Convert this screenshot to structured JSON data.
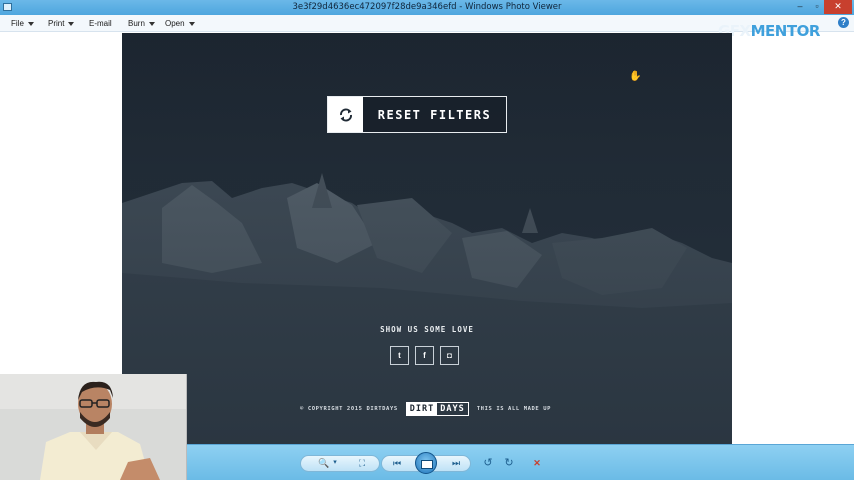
{
  "window": {
    "title": "3e3f29d4636ec472097f28de9a346efd - Windows Photo Viewer",
    "controls": {
      "minimize": "–",
      "maximize": "▫",
      "close": "✕"
    }
  },
  "menu": {
    "file": "File",
    "print": "Print",
    "email": "E-mail",
    "burn": "Burn",
    "open": "Open",
    "help": "?"
  },
  "watermark": {
    "part1": "GFX",
    "part2": "MENTOR"
  },
  "photo": {
    "reset_button": "RESET FILTERS",
    "love_text": "SHOW US SOME LOVE",
    "socials": [
      {
        "icon": "twitter-icon",
        "glyph": "t"
      },
      {
        "icon": "facebook-icon",
        "glyph": "f"
      },
      {
        "icon": "instagram-icon",
        "glyph": "◘"
      }
    ],
    "copyright": "© COPYRIGHT 2015 DIRTDAYS",
    "brand_a": "DIRT",
    "brand_b": "DAYS",
    "tagline": "THIS IS ALL MADE UP"
  },
  "toolbar": {
    "zoom": "🔍",
    "zoom_caret": "▾",
    "fit": "⛶",
    "prev": "⏮",
    "next": "⏭",
    "rotate_ccw": "↺",
    "rotate_cw": "↻",
    "delete": "✕"
  },
  "colors": {
    "titlebar": "#4ea6de",
    "photo_bg": "#1f2a35",
    "bottombar": "#7dc6ee",
    "delete": "#c8402e"
  }
}
